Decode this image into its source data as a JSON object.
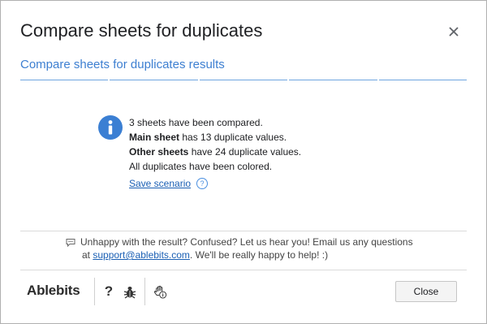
{
  "dialog": {
    "title": "Compare sheets for duplicates",
    "close_icon": "close-icon"
  },
  "step": {
    "title": "Compare sheets for duplicates results",
    "segments": 5,
    "accent_color": "#3d7fd1"
  },
  "result": {
    "icon": "info-icon",
    "line1": "3 sheets have been compared.",
    "line2_bold": "Main sheet",
    "line2_rest": " has 13 duplicate values.",
    "line3_bold": "Other sheets",
    "line3_rest": " have 24 duplicate values.",
    "line4": "All duplicates have been colored.",
    "save_scenario_label": "Save scenario",
    "help_icon": "question-circle-icon"
  },
  "feedback": {
    "icon": "chat-icon",
    "line1": "Unhappy with the result? Confused? Let us hear you! Email us any questions",
    "line2_prefix": "at ",
    "email": "support@ablebits.com",
    "line2_suffix": ". We'll be really happy to help! :)"
  },
  "footer": {
    "brand": "Ablebits",
    "help_label": "?",
    "bug_icon": "bug-icon",
    "privacy_icon": "hand-info-icon",
    "close_label": "Close"
  }
}
